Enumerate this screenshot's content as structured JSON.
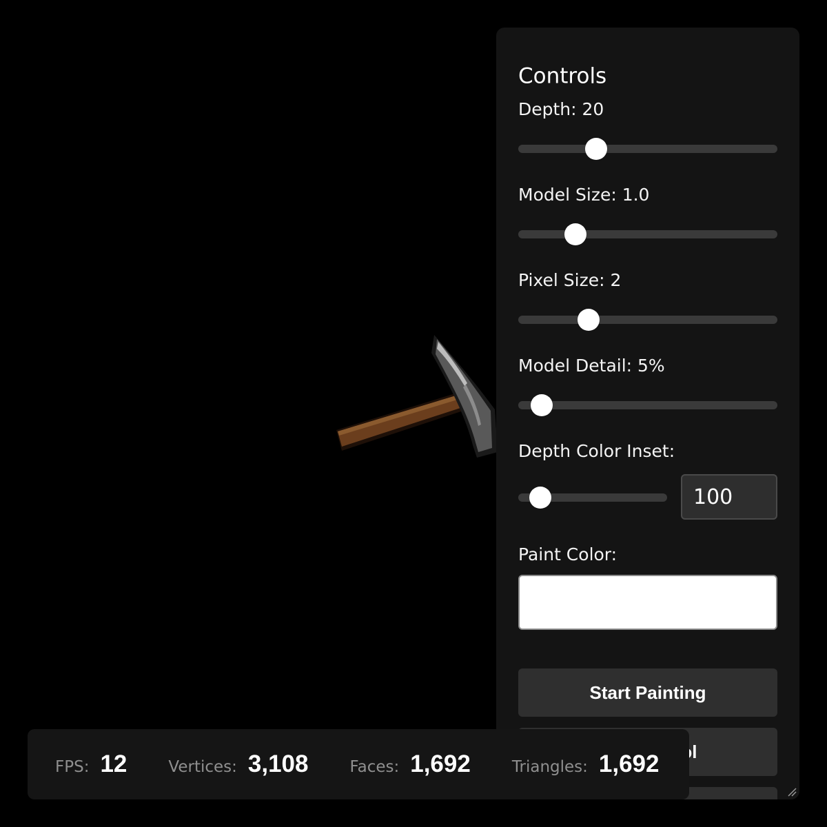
{
  "controls": {
    "title": "Controls",
    "depth": {
      "label": "Depth: 20",
      "value": 20,
      "slider_fraction": 0.3
    },
    "model_size": {
      "label": "Model Size: 1.0",
      "value": 1.0,
      "slider_fraction": 0.22
    },
    "pixel_size": {
      "label": "Pixel Size: 2",
      "value": 2,
      "slider_fraction": 0.27
    },
    "model_detail": {
      "label": "Model Detail: 5%",
      "value": "5%",
      "slider_fraction": 0.09
    },
    "depth_color_inset": {
      "label": "Depth Color Inset:",
      "input_value": "100",
      "slider_fraction": 0.15
    },
    "paint_color": {
      "label": "Paint Color:",
      "value": "#ffffff"
    },
    "buttons": {
      "start_painting": "Start Painting",
      "tool_partial": "Tool"
    }
  },
  "stats": {
    "fps": {
      "label": "FPS:",
      "value": "12"
    },
    "vertices": {
      "label": "Vertices:",
      "value": "3,108"
    },
    "faces": {
      "label": "Faces:",
      "value": "1,692"
    },
    "triangles": {
      "label": "Triangles:",
      "value": "1,692"
    }
  },
  "colors": {
    "background": "#000000",
    "panel": "#141414",
    "slider_track": "#3a3a3a",
    "button": "#2f2f2f",
    "handle_wood": "#6b3e1d",
    "pick_head": "#5a5a5a"
  }
}
